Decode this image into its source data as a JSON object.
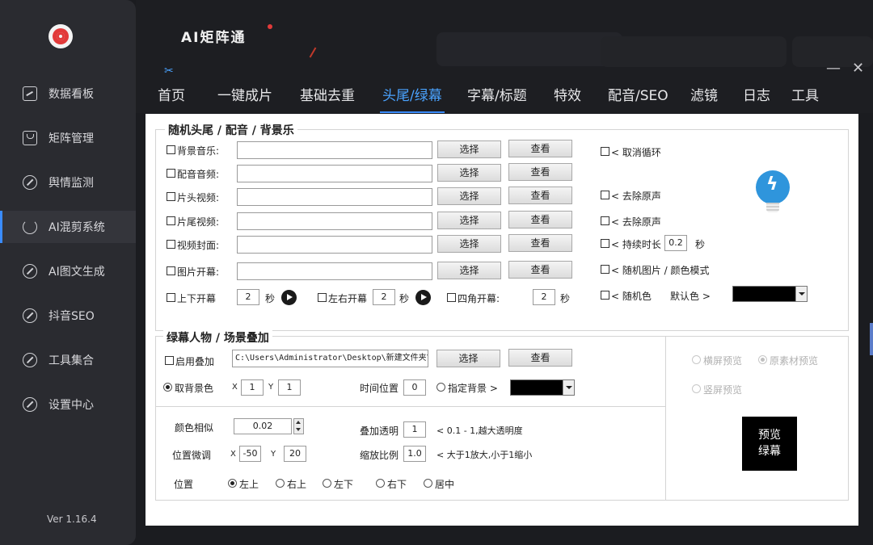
{
  "app": {
    "brand": "AI矩阵通",
    "version": "Ver 1.16.4",
    "minimize": "—",
    "close": "✕"
  },
  "sidebar": {
    "items": [
      {
        "label": "数据看板",
        "icon": "monitor-icon"
      },
      {
        "label": "矩阵管理",
        "icon": "box-icon"
      },
      {
        "label": "舆情监测",
        "icon": "circle-slash-icon"
      },
      {
        "label": "AI混剪系统",
        "icon": "refresh-icon",
        "active": true
      },
      {
        "label": "AI图文生成",
        "icon": "circle-slash-icon"
      },
      {
        "label": "抖音SEO",
        "icon": "circle-slash-icon"
      },
      {
        "label": "工具集合",
        "icon": "circle-slash-icon"
      },
      {
        "label": "设置中心",
        "icon": "circle-slash-icon"
      }
    ]
  },
  "tabs": [
    {
      "label": "首页"
    },
    {
      "label": "一键成片"
    },
    {
      "label": "基础去重"
    },
    {
      "label": "头尾/绿幕",
      "active": true
    },
    {
      "label": "字幕/标题"
    },
    {
      "label": "特效"
    },
    {
      "label": "配音/SEO"
    },
    {
      "label": "滤镜"
    },
    {
      "label": "日志"
    },
    {
      "label": "工具"
    }
  ],
  "section1": {
    "title": "随机头尾 / 配音 / 背景乐",
    "rows": [
      {
        "label": "背景音乐:",
        "path": "",
        "select": "选择",
        "view": "查看"
      },
      {
        "label": "配音音频:",
        "path": "",
        "select": "选择",
        "view": "查看"
      },
      {
        "label": "片头视频:",
        "path": "",
        "select": "选择",
        "view": "查看"
      },
      {
        "label": "片尾视频:",
        "path": "",
        "select": "选择",
        "view": "查看"
      },
      {
        "label": "视频封面:",
        "path": "",
        "select": "选择",
        "view": "查看"
      },
      {
        "label": "图片开幕:",
        "path": "",
        "select": "选择",
        "view": "查看"
      }
    ],
    "right_options": {
      "cancel_loop": "< 取消循环",
      "remove_audio_head": "< 去除原声",
      "remove_audio_tail": "< 去除原声",
      "duration_label": "< 持续时长",
      "duration_value": "0.2",
      "duration_unit": "秒",
      "random_image": "< 随机图片 / 颜色模式",
      "random_color": "< 随机色",
      "default_color_label": "默认色 >"
    },
    "openers": {
      "vertical": {
        "label": "上下开幕",
        "value": "2",
        "unit": "秒"
      },
      "horizontal": {
        "label": "左右开幕",
        "value": "2",
        "unit": "秒"
      },
      "corner": {
        "label": "四角开幕:",
        "value": "2",
        "unit": "秒"
      }
    }
  },
  "section2": {
    "title": "绿幕人物 / 场景叠加",
    "enable_label": "启用叠加",
    "path": "C:\\Users\\Administrator\\Desktop\\新建文件夹\\ex",
    "select": "选择",
    "view": "查看",
    "take_bg_color": "取背景色",
    "x_label": "X",
    "x_value": "1",
    "y_label": "Y",
    "y_value": "1",
    "time_pos_label": "时间位置",
    "time_pos_value": "0",
    "specify_bg": "指定背景 >",
    "color_similar_label": "颜色相似",
    "color_similar_value": "0.02",
    "overlay_alpha_label": "叠加透明",
    "overlay_alpha_value": "1",
    "overlay_alpha_hint": "< 0.1 - 1,越大透明度",
    "pos_adjust_label": "位置微调",
    "pos_x_label": "X",
    "pos_x_value": "-50",
    "pos_y_label": "Y",
    "pos_y_value": "20",
    "scale_label": "缩放比例",
    "scale_value": "1.0",
    "scale_hint": "< 大于1放大,小于1缩小",
    "position_label": "位置",
    "positions": [
      "左上",
      "右上",
      "左下",
      "右下",
      "居中"
    ],
    "preview": {
      "landscape": "横屏预览",
      "original": "原素材预览",
      "portrait": "竖屏预览",
      "button": "预览\n绿幕"
    }
  },
  "colors": {
    "accent": "#3a8cff",
    "sidebar_bg": "#2a2b30",
    "bolt": "#2f95dc"
  }
}
